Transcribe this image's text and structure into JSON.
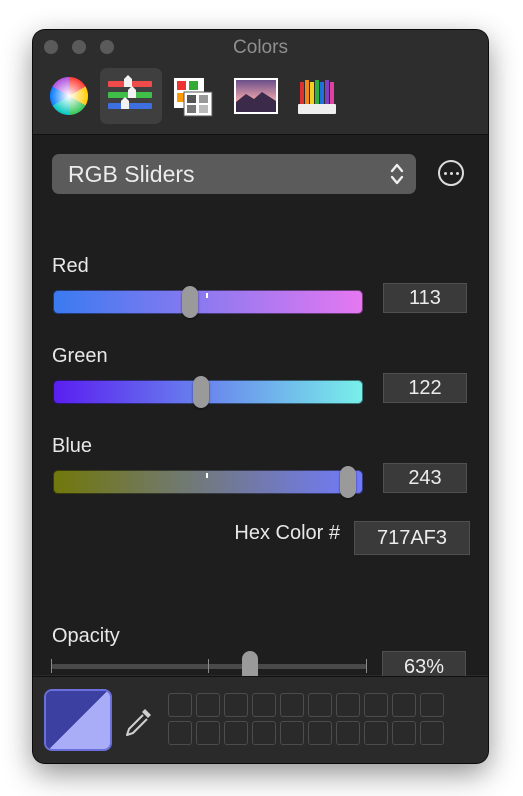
{
  "window": {
    "title": "Colors"
  },
  "toolbar": {
    "tabs": [
      {
        "name": "color-wheel",
        "selected": false
      },
      {
        "name": "color-sliders",
        "selected": true
      },
      {
        "name": "color-palettes",
        "selected": false
      },
      {
        "name": "image-palettes",
        "selected": false
      },
      {
        "name": "pencils",
        "selected": false
      }
    ]
  },
  "mode": {
    "selected": "RGB Sliders"
  },
  "sliders": [
    {
      "label": "Red",
      "value": "113",
      "fraction": 0.443,
      "gradient": [
        "#3a7af0",
        "#e678f0"
      ]
    },
    {
      "label": "Green",
      "value": "122",
      "fraction": 0.478,
      "gradient": [
        "#5a1ef0",
        "#78f0ea"
      ]
    },
    {
      "label": "Blue",
      "value": "243",
      "fraction": 0.953,
      "gradient": [
        "#71780a",
        "#717aff"
      ]
    }
  ],
  "hex": {
    "label": "Hex Color #",
    "value": "717AF3"
  },
  "opacity": {
    "label": "Opacity",
    "value": "63%",
    "fraction": 0.63
  },
  "current_color": {
    "hex": "#717AF3"
  },
  "icons": {
    "more": "more-options-icon",
    "dropdown": "chevron-updown-icon",
    "picker": "eyedropper-icon"
  },
  "swatches": {
    "rows": 2,
    "columns": 10
  }
}
